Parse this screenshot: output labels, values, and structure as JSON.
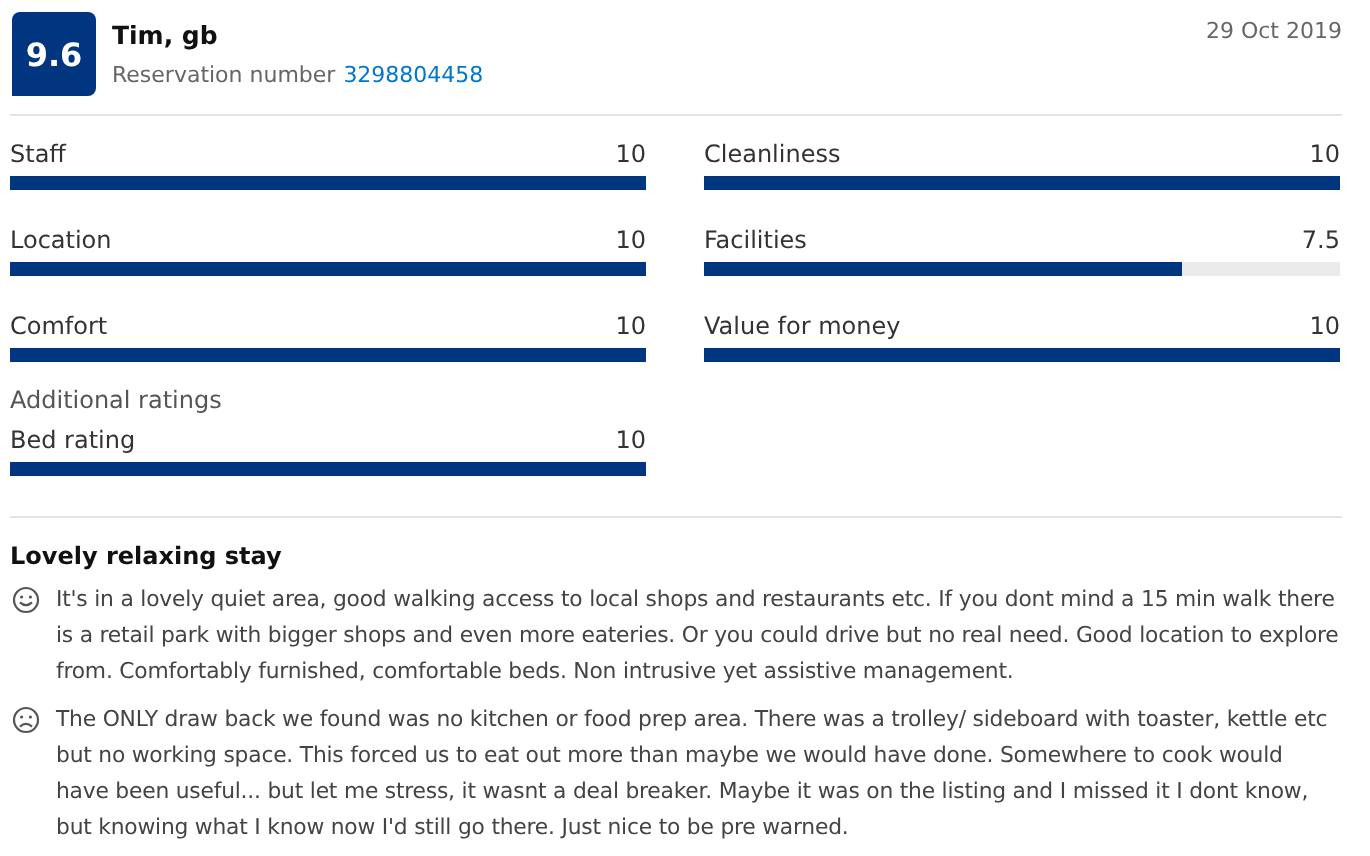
{
  "reviewer": {
    "score": "9.6",
    "name": "Tim, gb",
    "reservation_label": "Reservation number",
    "reservation_number": "3298804458",
    "date": "29 Oct 2019"
  },
  "ratings": [
    {
      "label": "Staff",
      "score": "10",
      "level": 1
    },
    {
      "label": "Cleanliness",
      "score": "10",
      "level": 1
    },
    {
      "label": "Location",
      "score": "10",
      "level": 1
    },
    {
      "label": "Facilities",
      "score": "7.5",
      "level": 0.75
    },
    {
      "label": "Comfort",
      "score": "10",
      "level": 1
    },
    {
      "label": "Value for money",
      "score": "10",
      "level": 1
    }
  ],
  "additional_ratings": {
    "heading": "Additional ratings",
    "items": [
      {
        "label": "Bed rating",
        "score": "10",
        "level": 1
      }
    ]
  },
  "review": {
    "title": "Lovely relaxing stay",
    "comments": [
      {
        "kind": "positive",
        "text": "It's in a lovely quiet area, good walking access to local shops and restaurants etc. If you dont mind a 15 min walk there is a retail park with bigger shops and even more eateries. Or you could drive but no real need. Good location to explore from. Comfortably furnished, comfortable beds. Non intrusive yet assistive management."
      },
      {
        "kind": "negative",
        "text": "The ONLY draw back we found was no kitchen or food prep area. There was a trolley/ sideboard with toaster, kettle etc but no working space. This forced us to eat out more than maybe we would have done. Somewhere to cook would have been useful... but let me stress, it wasnt a deal breaker. Maybe it was on the listing and I missed it I dont know, but knowing what I know now I'd still go there. Just nice to be pre warned."
      }
    ]
  }
}
